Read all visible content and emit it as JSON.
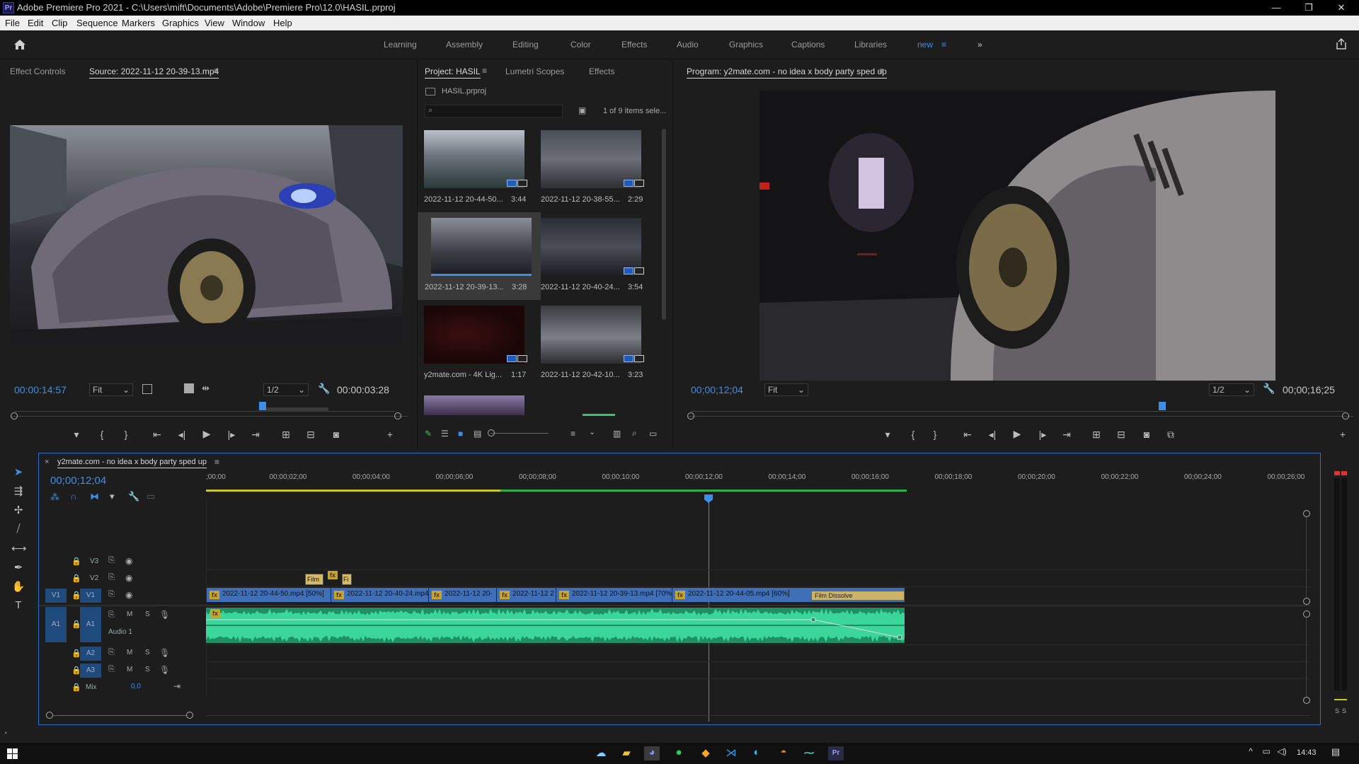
{
  "window": {
    "title": "Adobe Premiere Pro 2021 - C:\\Users\\mift\\Documents\\Adobe\\Premiere Pro\\12.0\\HASIL.prproj",
    "app_badge": "Pr",
    "controls": [
      "—",
      "❐",
      "✕"
    ]
  },
  "menu": [
    "File",
    "Edit",
    "Clip",
    "Sequence",
    "Markers",
    "Graphics",
    "View",
    "Window",
    "Help"
  ],
  "workspaces": {
    "items": [
      "Learning",
      "Assembly",
      "Editing",
      "Color",
      "Effects",
      "Audio",
      "Graphics",
      "Captions",
      "Libraries",
      "new"
    ],
    "active": "new",
    "overflow_icon": "»"
  },
  "source_panel": {
    "tabs": [
      "Effect Controls",
      "Source: 2022-11-12 20-39-13.mp4"
    ],
    "timecode": "00:00:14:57",
    "fit": "Fit",
    "resolution": "1/2",
    "duration": "00:00:03:28",
    "playhead_fraction": 0.65
  },
  "project_panel": {
    "tabs": [
      "Project: HASIL",
      "Lumetri Scopes",
      "Effects"
    ],
    "file": "HASIL.prproj",
    "search_placeholder": "",
    "count": "1 of 9 items sele...",
    "items": [
      {
        "name": "2022-11-12 20-44-50...",
        "duration": "3:44"
      },
      {
        "name": "2022-11-12 20-38-55...",
        "duration": "2:29"
      },
      {
        "name": "2022-11-12 20-39-13...",
        "duration": "3:28"
      },
      {
        "name": "2022-11-12 20-40-24...",
        "duration": "3:54"
      },
      {
        "name": "y2mate.com - 4K Lig...",
        "duration": "1:17"
      },
      {
        "name": "2022-11-12 20-42-10...",
        "duration": "3:23"
      }
    ]
  },
  "program_panel": {
    "title": "Program: y2mate.com - no idea x body party sped up",
    "timecode": "00;00;12;04",
    "fit": "Fit",
    "resolution": "1/2",
    "duration": "00;00;16;25",
    "playhead_fraction": 0.72
  },
  "timeline": {
    "sequence_name": "y2mate.com - no idea x body party sped up",
    "timecode": "00;00;12;04",
    "ruler_labels": [
      ";00;00",
      "00;00;02;00",
      "00;00;04;00",
      "00;00;06;00",
      "00;00;08;00",
      "00;00;10;00",
      "00;00;12;00",
      "00;00;14;00",
      "00;00;16;00",
      "00;00;18;00",
      "00;00;20;00",
      "00;00;22;00",
      "00;00;24;00",
      "00;00;26;00"
    ],
    "tracks": {
      "video": [
        "V3",
        "V2",
        "V1"
      ],
      "audio": [
        "A1",
        "A2",
        "A3"
      ],
      "audio1_name": "Audio 1",
      "mix_label": "Mix",
      "mix_value": "0,0",
      "src_video": "V1",
      "src_audio": "A1"
    },
    "v2_clips": [
      "Film",
      "Fi"
    ],
    "v1_clips": [
      "2022-11-12 20-44-50.mp4 [50%]",
      "2022-11-12 20-40-24.mp4 [",
      "2022-11-12 20-",
      "2022-11-12 2",
      "2022-11-12 20-39-13.mp4 [70%]",
      "2022-11-12 20-44-05.mp4 [60%]"
    ],
    "transition": "Film Dissolve",
    "mute_label": "M",
    "solo_label": "S"
  },
  "meters": {
    "labels": [
      "S",
      "S"
    ]
  },
  "taskbar": {
    "time": "14:43"
  },
  "colors": {
    "accent": "#3d8ee6",
    "video_clip": "#3f6fb6",
    "audio_clip": "#2fbf8a",
    "fx": "#c8a429"
  }
}
